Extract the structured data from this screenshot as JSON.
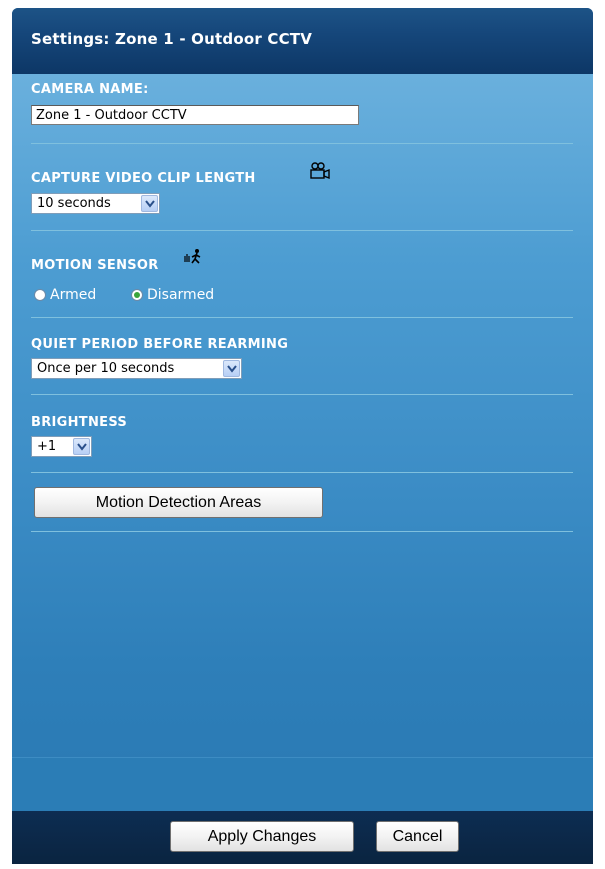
{
  "window": {
    "title": "Settings: Zone 1 - Outdoor CCTV"
  },
  "camera_name": {
    "label": "CAMERA NAME:",
    "value": "Zone 1 - Outdoor CCTV"
  },
  "clip_length": {
    "label": "CAPTURE VIDEO CLIP LENGTH",
    "selected": "10 seconds",
    "icon": "video-camera-icon"
  },
  "motion_sensor": {
    "label": "MOTION SENSOR",
    "icon": "motion-person-icon",
    "options": [
      {
        "label": "Armed",
        "checked": false
      },
      {
        "label": "Disarmed",
        "checked": true
      }
    ]
  },
  "quiet_period": {
    "label": "QUIET PERIOD BEFORE REARMING",
    "selected": "Once per 10 seconds"
  },
  "brightness": {
    "label": "BRIGHTNESS",
    "selected": "+1"
  },
  "actions": {
    "motion_areas_label": "Motion Detection Areas",
    "apply_label": "Apply Changes",
    "cancel_label": "Cancel"
  },
  "colors": {
    "title_bar": "#15467a",
    "panel_light": "#6ab0dd",
    "panel_dark": "#2a79b3",
    "footer": "#0d2d52",
    "radio_checked": "#3ba43a"
  }
}
